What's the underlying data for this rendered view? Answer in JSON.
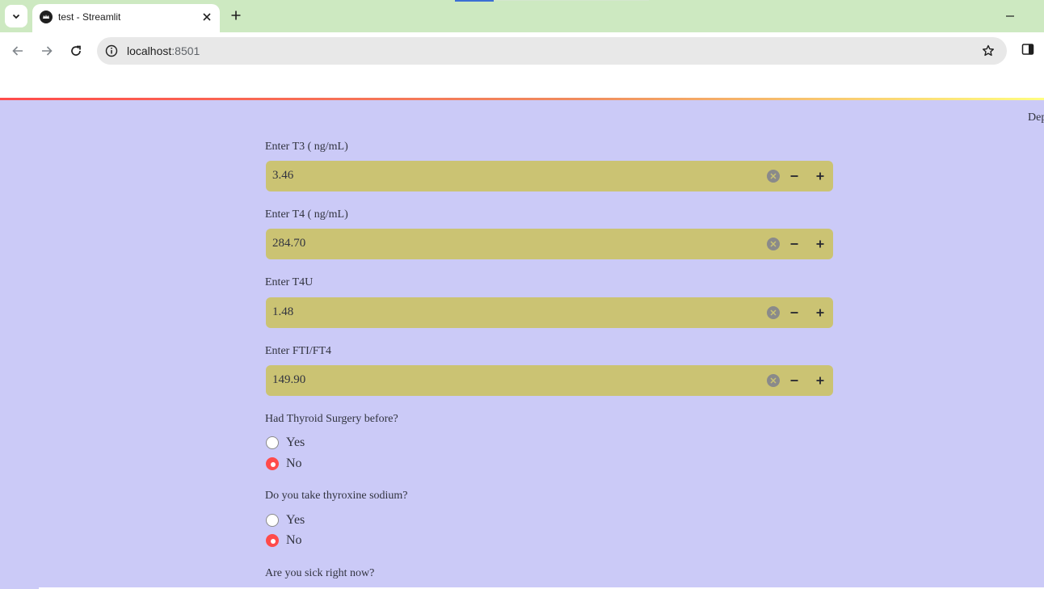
{
  "browser": {
    "tab_title": "test - Streamlit",
    "url_host": "localhost",
    "url_port": ":8501"
  },
  "app": {
    "deploy_label": "Dep",
    "number_inputs": [
      {
        "label": "Enter T3 ( ng/mL)",
        "value": "3.46"
      },
      {
        "label": "Enter T4 ( ng/mL)",
        "value": "284.70"
      },
      {
        "label": "Enter T4U",
        "value": "1.48"
      },
      {
        "label": "Enter FTI/FT4",
        "value": "149.90"
      }
    ],
    "radio_groups": [
      {
        "label": "Had Thyroid Surgery before?",
        "options": [
          "Yes",
          "No"
        ],
        "selected": "No"
      },
      {
        "label": "Do you take thyroxine sodium?",
        "options": [
          "Yes",
          "No"
        ],
        "selected": "No"
      },
      {
        "label": "Are you sick right now?"
      }
    ]
  },
  "colors": {
    "background": "#cbcaf7",
    "input_background": "#cbc373",
    "accent": "#ff4b4b",
    "tabbar": "#cde9c1"
  },
  "icons": [
    "tab-search-icon",
    "streamlit-favicon",
    "close-icon",
    "plus-icon",
    "minimize-icon",
    "back-arrow-icon",
    "forward-arrow-icon",
    "reload-icon",
    "info-icon",
    "star-icon",
    "side-panel-icon",
    "clear-icon",
    "minus-icon"
  ]
}
